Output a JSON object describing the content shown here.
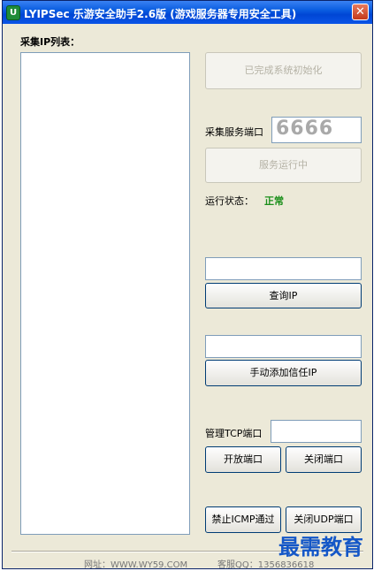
{
  "window": {
    "title": "LYIPSec 乐游安全助手2.6版 (游戏服务器专用安全工具)",
    "app_icon_glyph": "U",
    "close_glyph": "✕"
  },
  "left": {
    "list_label": "采集IP列表："
  },
  "right": {
    "init_button": "已完成系统初始化",
    "collect_port_label": "采集服务端口",
    "collect_port_value": "6666",
    "service_button": "服务运行中",
    "status_label": "运行状态：",
    "status_value": "正常",
    "query_input_value": "",
    "query_button": "查询IP",
    "trust_input_value": "",
    "trust_button": "手动添加信任IP",
    "tcp_port_label": "管理TCP端口",
    "tcp_port_value": "",
    "open_port_button": "开放端口",
    "close_port_button": "关闭端口",
    "block_icmp_button": "禁止ICMP通过",
    "close_udp_button": "关闭UDP端口"
  },
  "footer": {
    "website": "网址：WWW.WY59.COM",
    "support": "客服QQ：1356836618"
  },
  "watermark": "最需教育",
  "colors": {
    "titlebar": "#0a5de0",
    "status_ok": "#1a8f1a",
    "watermark": "#1457c7"
  }
}
